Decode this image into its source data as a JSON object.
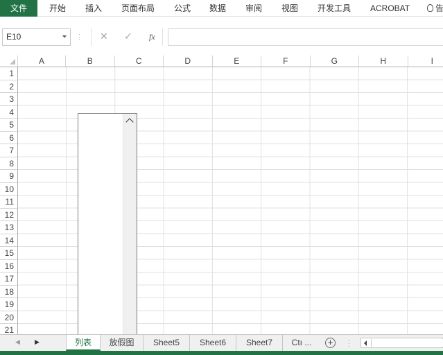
{
  "ribbon": {
    "tabs": [
      {
        "label": "文件",
        "name": "tab-file"
      },
      {
        "label": "开始",
        "name": "tab-home"
      },
      {
        "label": "插入",
        "name": "tab-insert"
      },
      {
        "label": "页面布局",
        "name": "tab-page-layout"
      },
      {
        "label": "公式",
        "name": "tab-formulas"
      },
      {
        "label": "数据",
        "name": "tab-data"
      },
      {
        "label": "审阅",
        "name": "tab-review"
      },
      {
        "label": "视图",
        "name": "tab-view"
      },
      {
        "label": "开发工具",
        "name": "tab-developer"
      },
      {
        "label": "ACROBAT",
        "name": "tab-acrobat"
      }
    ],
    "tell_me": "告"
  },
  "formula_bar": {
    "name_box": "E10",
    "cancel_glyph": "✕",
    "enter_glyph": "✓",
    "fx_glyph": "fx",
    "formula": ""
  },
  "grid": {
    "columns": [
      "A",
      "B",
      "C",
      "D",
      "E",
      "F",
      "G",
      "H",
      "I"
    ],
    "rows": [
      "1",
      "2",
      "3",
      "4",
      "5",
      "6",
      "7",
      "8",
      "9",
      "10",
      "11",
      "12",
      "13",
      "14",
      "15",
      "16",
      "17",
      "18",
      "19",
      "20",
      "21"
    ]
  },
  "sheets": {
    "tabs": [
      {
        "label": "列表",
        "active": true
      },
      {
        "label": "放假图",
        "active": false
      },
      {
        "label": "Sheet5",
        "active": false
      },
      {
        "label": "Sheet6",
        "active": false
      },
      {
        "label": "Sheet7",
        "active": false
      },
      {
        "label": "Ctı ...",
        "active": false
      }
    ],
    "add_glyph": "+"
  },
  "colors": {
    "accent": "#217346",
    "gridline": "#e1e1e1"
  }
}
